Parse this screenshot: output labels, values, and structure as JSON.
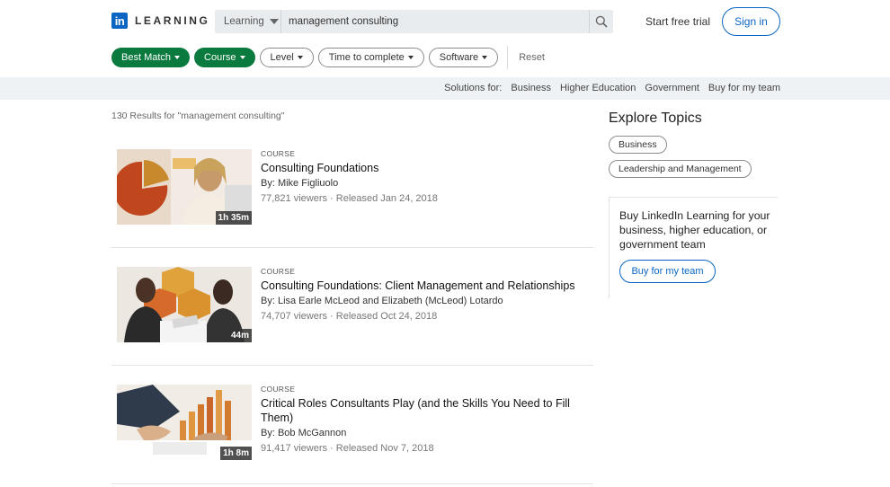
{
  "header": {
    "logo_in": "in",
    "logo_text": "LEARNING",
    "search_category": "Learning",
    "search_value": "management consulting",
    "free_trial": "Start free trial",
    "sign_in": "Sign in"
  },
  "filters": {
    "items": [
      {
        "label": "Best Match",
        "active": true
      },
      {
        "label": "Course",
        "active": true
      },
      {
        "label": "Level",
        "active": false
      },
      {
        "label": "Time to complete",
        "active": false
      },
      {
        "label": "Software",
        "active": false
      }
    ],
    "reset": "Reset"
  },
  "solutions": {
    "label": "Solutions for:",
    "links": [
      "Business",
      "Higher Education",
      "Government",
      "Buy for my team"
    ]
  },
  "results": {
    "count_text": "130 Results for \"management consulting\"",
    "items": [
      {
        "type": "COURSE",
        "title": "Consulting Foundations",
        "author": "By: Mike Figliuolo",
        "stats": "77,821 viewers · Released Jan 24, 2018",
        "duration": "1h 35m"
      },
      {
        "type": "COURSE",
        "title": "Consulting Foundations: Client Management and Relationships",
        "author": "By: Lisa Earle McLeod and Elizabeth (McLeod) Lotardo",
        "stats": "74,707 viewers · Released Oct 24, 2018",
        "duration": "44m"
      },
      {
        "type": "COURSE",
        "title": "Critical Roles Consultants Play (and the Skills You Need to Fill Them)",
        "author": "By: Bob McGannon",
        "stats": "91,417 viewers · Released Nov 7, 2018",
        "duration": "1h 8m"
      }
    ]
  },
  "sidebar": {
    "title": "Explore Topics",
    "topics": [
      "Business",
      "Leadership and Management"
    ],
    "promo_text": "Buy LinkedIn Learning for your business, higher education, or government team",
    "promo_button": "Buy for my team"
  },
  "colors": {
    "brand_blue": "#0a66c2",
    "filter_green": "#0b7a3e"
  }
}
